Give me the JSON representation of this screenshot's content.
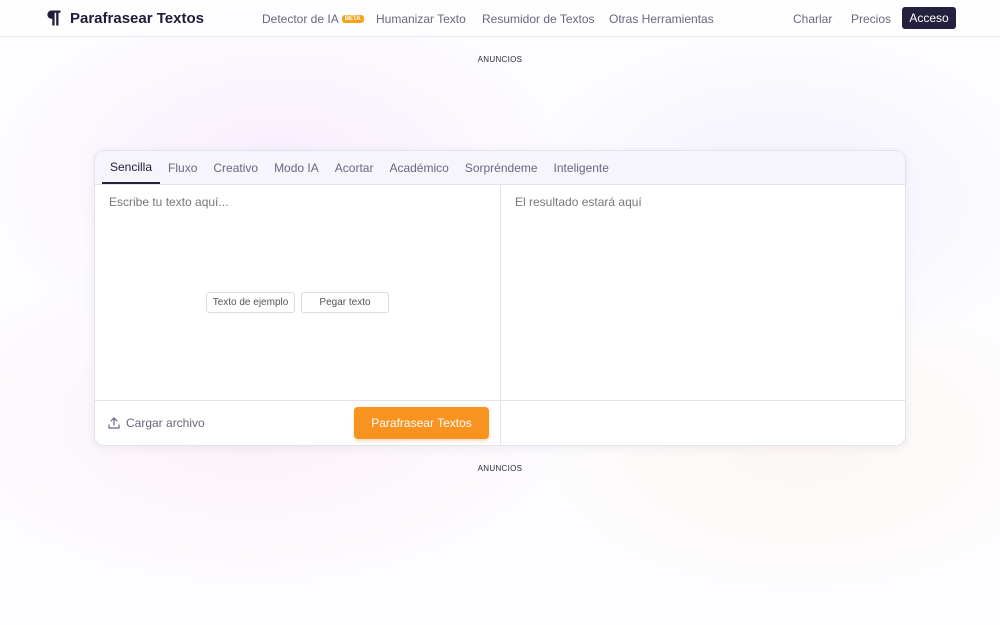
{
  "header": {
    "logo_text": "Parafrasear Textos",
    "nav": {
      "ai_detector": "Detector de IA",
      "ai_detector_badge": "BETA",
      "humanize": "Humanizar Texto",
      "summarizer": "Resumidor de Textos",
      "other_tools": "Otras Herramientas",
      "chat": "Charlar",
      "pricing": "Precios"
    },
    "login_label": "Acceso"
  },
  "ads_top": "ANUNCIOS",
  "ads_bottom": "ANUNCIOS",
  "modes": [
    "Sencilla",
    "Fluxo",
    "Creativo",
    "Modo IA",
    "Acortar",
    "Académico",
    "Sorpréndeme",
    "Inteligente"
  ],
  "editor": {
    "input_placeholder": "Escribe tu texto aquí...",
    "output_placeholder": "El resultado estará aquí",
    "sample_text_label": "Texto de ejemplo",
    "paste_text_label": "Pegar texto",
    "upload_label": "Cargar archivo",
    "submit_label": "Parafrasear Textos"
  },
  "colors": {
    "accent": "#f7931e",
    "brand_dark": "#24213f",
    "badge": "#f7a21b"
  },
  "icons": {
    "logo": "pilcrow-icon",
    "upload": "upload-icon"
  }
}
